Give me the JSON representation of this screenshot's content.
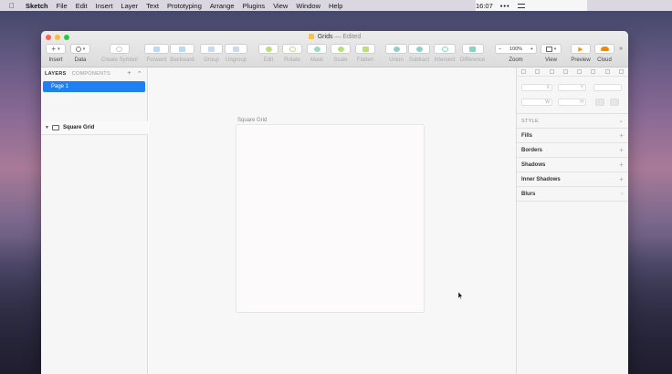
{
  "menubar": {
    "app": "Sketch",
    "items": [
      "File",
      "Edit",
      "Insert",
      "Layer",
      "Text",
      "Prototyping",
      "Arrange",
      "Plugins",
      "View",
      "Window",
      "Help"
    ],
    "clock": "16:07"
  },
  "window": {
    "title": "Grids",
    "edited": "— Edited"
  },
  "toolbar": {
    "insert": "Insert",
    "data": "Data",
    "create_symbol": "Create Symbol",
    "forward": "Forward",
    "backward": "Backward",
    "group": "Group",
    "ungroup": "Ungroup",
    "edit": "Edit",
    "rotate": "Rotate",
    "mask": "Mask",
    "scale": "Scale",
    "flatten": "Flatten",
    "union": "Union",
    "subtract": "Subtract",
    "intersect": "Intersect",
    "difference": "Difference",
    "zoom": "Zoom",
    "zoom_value": "100%",
    "view": "View",
    "preview": "Preview",
    "cloud": "Cloud"
  },
  "layers_panel": {
    "tab_layers": "LAYERS",
    "tab_components": "COMPONENTS",
    "page": "Page 1",
    "layer": "Square Grid"
  },
  "canvas": {
    "artboard_label": "Square Grid"
  },
  "inspector": {
    "x_label": "X",
    "y_label": "Y",
    "w_label": "W",
    "h_label": "H",
    "style": "STYLE",
    "fills": "Fills",
    "borders": "Borders",
    "shadows": "Shadows",
    "inner_shadows": "Inner Shadows",
    "blurs": "Blurs"
  },
  "colors": {
    "accent": "#1e80f2",
    "close": "#fe5f57",
    "minimize": "#febc2e",
    "zoom": "#28c840",
    "preview": "#f39c12",
    "cloud": "#f28b00"
  }
}
